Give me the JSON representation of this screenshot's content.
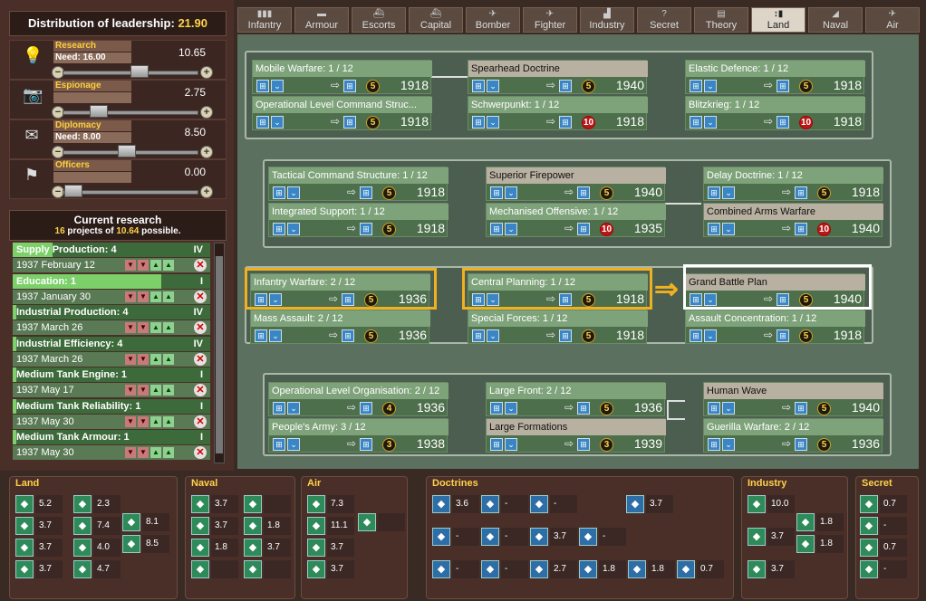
{
  "header": {
    "label": "Distribution of leadership:",
    "value": "21.90"
  },
  "sliders": [
    {
      "name": "Research",
      "need": "Need: 16.00",
      "value": "10.65",
      "icon": "lightbulb-icon",
      "glyph": "💡",
      "thumb": 0.52
    },
    {
      "name": "Espionage",
      "need": "",
      "value": "2.75",
      "icon": "camera-icon",
      "glyph": "📷",
      "thumb": 0.2
    },
    {
      "name": "Diplomacy",
      "need": "Need: 8.00",
      "value": "8.50",
      "icon": "envelope-icon",
      "glyph": "✉",
      "thumb": 0.42
    },
    {
      "name": "Officers",
      "need": "",
      "value": "0.00",
      "icon": "flag-icon",
      "glyph": "⚑",
      "thumb": 0.0
    }
  ],
  "current_research": {
    "title": "Current research",
    "count": "16",
    "mid": " projects of ",
    "possible": "10.64",
    "suffix": " possible."
  },
  "queue": [
    {
      "name": "Supply Production: 4",
      "date": "1937 February 12",
      "level": "IV",
      "progress": 0.2
    },
    {
      "name": "Education: 1",
      "date": "1937 January 30",
      "level": "I",
      "progress": 0.75
    },
    {
      "name": "Industrial Production: 4",
      "date": "1937 March 26",
      "level": "IV",
      "progress": 0.02
    },
    {
      "name": "Industrial Efficiency: 4",
      "date": "1937 March 26",
      "level": "IV",
      "progress": 0.02
    },
    {
      "name": "Medium Tank Engine: 1",
      "date": "1937 May 17",
      "level": "I",
      "progress": 0.02
    },
    {
      "name": "Medium Tank Reliability: 1",
      "date": "1937 May 30",
      "level": "I",
      "progress": 0.02
    },
    {
      "name": "Medium Tank Armour: 1",
      "date": "1937 May 30",
      "level": "I",
      "progress": 0.02
    }
  ],
  "tabs": [
    {
      "label": "Infantry",
      "icon": "infantry-icon",
      "glyph": "▮▮▮"
    },
    {
      "label": "Armour",
      "icon": "tank-icon",
      "glyph": "▬"
    },
    {
      "label": "Escorts",
      "icon": "escort-ship-icon",
      "glyph": "⛴"
    },
    {
      "label": "Capital",
      "icon": "battleship-icon",
      "glyph": "⛴"
    },
    {
      "label": "Bomber",
      "icon": "bomber-icon",
      "glyph": "✈"
    },
    {
      "label": "Fighter",
      "icon": "fighter-icon",
      "glyph": "✈"
    },
    {
      "label": "Industry",
      "icon": "factory-icon",
      "glyph": "▟"
    },
    {
      "label": "Secret",
      "icon": "question-icon",
      "glyph": "?"
    },
    {
      "label": "Theory",
      "icon": "book-icon",
      "glyph": "▤"
    },
    {
      "label": "Land",
      "icon": "land-doctrine-icon",
      "glyph": "↕▮"
    },
    {
      "label": "Naval",
      "icon": "naval-doctrine-icon",
      "glyph": "◢"
    },
    {
      "label": "Air",
      "icon": "air-doctrine-icon",
      "glyph": "✈"
    }
  ],
  "active_tab": 9,
  "nodes": [
    {
      "title": "Mobile Warfare: 1 / 12",
      "cost": "5",
      "year": "1918",
      "red": false,
      "ok": true
    },
    {
      "title": "Spearhead Doctrine",
      "cost": "5",
      "year": "1940",
      "red": false,
      "ok": false
    },
    {
      "title": "Elastic Defence: 1 / 12",
      "cost": "5",
      "year": "1918",
      "red": false,
      "ok": true
    },
    {
      "title": "Operational Level Command Struc...",
      "cost": "5",
      "year": "1918",
      "red": false,
      "ok": true
    },
    {
      "title": "Schwerpunkt: 1 / 12",
      "cost": "10",
      "year": "1918",
      "red": true,
      "ok": true
    },
    {
      "title": "Blitzkrieg: 1 / 12",
      "cost": "10",
      "year": "1918",
      "red": true,
      "ok": true
    },
    {
      "title": "Tactical Command Structure: 1 / 12",
      "cost": "5",
      "year": "1918",
      "red": false,
      "ok": true
    },
    {
      "title": "Superior Firepower",
      "cost": "5",
      "year": "1940",
      "red": false,
      "ok": false
    },
    {
      "title": "Delay Doctrine: 1 / 12",
      "cost": "5",
      "year": "1918",
      "red": false,
      "ok": true
    },
    {
      "title": "Integrated Support: 1 / 12",
      "cost": "5",
      "year": "1918",
      "red": false,
      "ok": true
    },
    {
      "title": "Mechanised Offensive: 1 / 12",
      "cost": "10",
      "year": "1935",
      "red": true,
      "ok": true
    },
    {
      "title": "Combined Arms Warfare",
      "cost": "10",
      "year": "1940",
      "red": true,
      "ok": false
    },
    {
      "title": "Infantry Warfare: 2 / 12",
      "cost": "5",
      "year": "1936",
      "red": false,
      "ok": true
    },
    {
      "title": "Central Planning: 1 / 12",
      "cost": "5",
      "year": "1918",
      "red": false,
      "ok": true
    },
    {
      "title": "Grand Battle Plan",
      "cost": "5",
      "year": "1940",
      "red": false,
      "ok": false
    },
    {
      "title": "Mass Assault: 2 / 12",
      "cost": "5",
      "year": "1936",
      "red": false,
      "ok": true
    },
    {
      "title": "Special Forces: 1 / 12",
      "cost": "5",
      "year": "1918",
      "red": false,
      "ok": true
    },
    {
      "title": "Assault Concentration: 1 / 12",
      "cost": "5",
      "year": "1918",
      "red": false,
      "ok": true
    },
    {
      "title": "Operational Level Organisation: 2 / 12",
      "cost": "4",
      "year": "1936",
      "red": false,
      "ok": true
    },
    {
      "title": "Large Front: 2 / 12",
      "cost": "5",
      "year": "1936",
      "red": false,
      "ok": true
    },
    {
      "title": "Human Wave",
      "cost": "5",
      "year": "1940",
      "red": false,
      "ok": false
    },
    {
      "title": "People's Army: 3 / 12",
      "cost": "3",
      "year": "1938",
      "red": false,
      "ok": true
    },
    {
      "title": "Large Formations",
      "cost": "3",
      "year": "1939",
      "red": false,
      "ok": false
    },
    {
      "title": "Guerilla Warfare: 2 / 12",
      "cost": "5",
      "year": "1936",
      "red": false,
      "ok": true
    }
  ],
  "bottom": {
    "land": {
      "label": "Land",
      "items": [
        "5.2",
        "2.3",
        "3.7",
        "7.4",
        "3.7",
        "4.0",
        "3.7",
        "4.7",
        "8.1",
        "8.5"
      ]
    },
    "naval": {
      "label": "Naval",
      "items": [
        "3.7",
        "",
        "3.7",
        "1.8",
        "1.8",
        "3.7",
        "",
        ""
      ]
    },
    "air": {
      "label": "Air",
      "items": [
        "7.3",
        "11.1",
        "3.7",
        "3.7",
        ""
      ]
    },
    "doctrines": {
      "label": "Doctrines",
      "items": [
        "3.6",
        "-",
        "-",
        "3.7",
        "-",
        "-",
        "3.7",
        "-",
        "-",
        "2.7",
        "1.8",
        "1.8",
        "0.7",
        "-"
      ]
    },
    "industry": {
      "label": "Industry",
      "items": [
        "10.0",
        "1.8",
        "3.7",
        "1.8",
        "3.7"
      ]
    },
    "secret": {
      "label": "Secret",
      "items": [
        "0.7",
        "-",
        "0.7",
        "-"
      ]
    }
  }
}
